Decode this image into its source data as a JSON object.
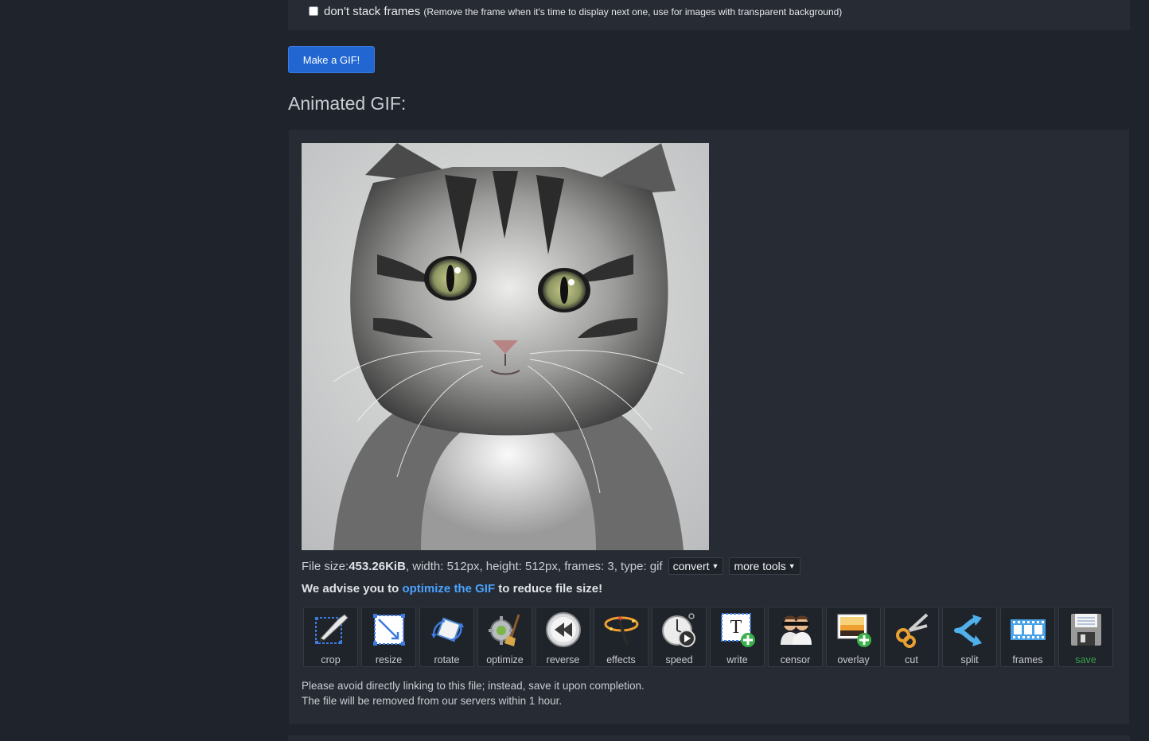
{
  "options": {
    "dont_stack_label": "don't stack frames",
    "dont_stack_note": "(Remove the frame when it's time to display next one, use for images with transparent background)",
    "dont_stack_checked": false
  },
  "make_button": "Make a GIF!",
  "section_title": "Animated GIF:",
  "file_info": {
    "prefix": "File size: ",
    "size": "453.26KiB",
    "details": ", width: 512px, height: 512px, frames: 3, type: gif",
    "convert_label": "convert",
    "more_tools_label": "more tools"
  },
  "advise": {
    "before": "We advise you to ",
    "link": "optimize the GIF",
    "after": " to reduce file size!"
  },
  "tools": [
    {
      "label": "crop",
      "icon": "crop-icon"
    },
    {
      "label": "resize",
      "icon": "resize-icon"
    },
    {
      "label": "rotate",
      "icon": "rotate-icon"
    },
    {
      "label": "optimize",
      "icon": "optimize-icon"
    },
    {
      "label": "reverse",
      "icon": "reverse-icon"
    },
    {
      "label": "effects",
      "icon": "effects-icon"
    },
    {
      "label": "speed",
      "icon": "speed-icon"
    },
    {
      "label": "write",
      "icon": "write-icon"
    },
    {
      "label": "censor",
      "icon": "censor-icon"
    },
    {
      "label": "overlay",
      "icon": "overlay-icon"
    },
    {
      "label": "cut",
      "icon": "cut-icon"
    },
    {
      "label": "split",
      "icon": "split-icon"
    },
    {
      "label": "frames",
      "icon": "frames-icon"
    },
    {
      "label": "save",
      "icon": "save-icon"
    }
  ],
  "notes": {
    "line1": "Please avoid directly linking to this file; instead, save it upon completion.",
    "line2": "The file will be removed from our servers within 1 hour."
  },
  "colors": {
    "page_bg": "#1f232b",
    "panel_bg": "#272b33",
    "primary_button": "#2166d1",
    "link": "#4aa3ff",
    "save_label": "#39a24a"
  }
}
